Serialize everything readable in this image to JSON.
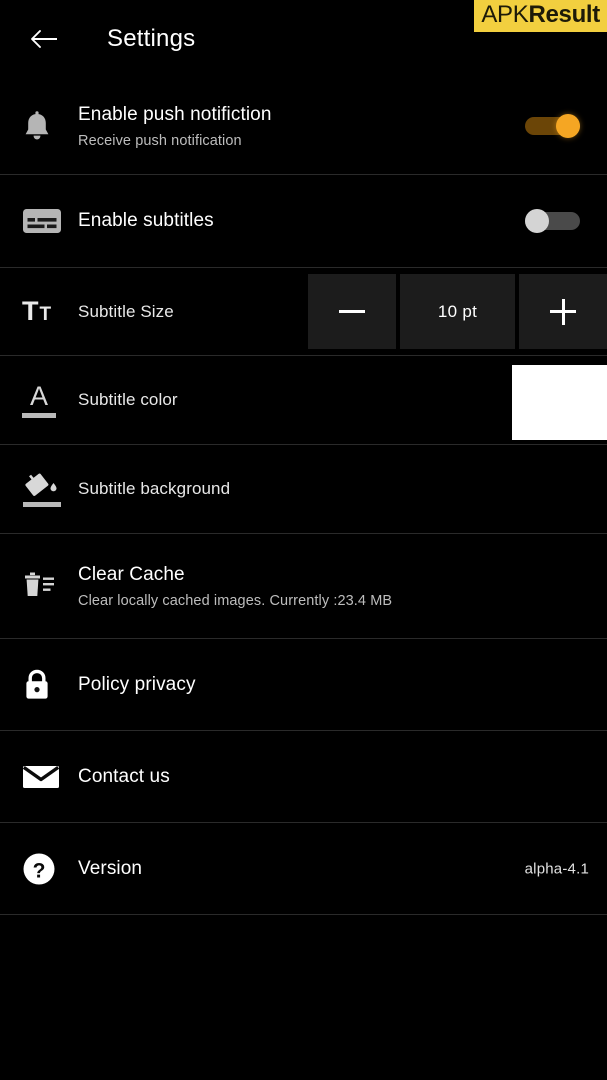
{
  "watermark": {
    "part1": "APK",
    "part2": "Result",
    "bg_color": "#f2cf3f"
  },
  "header": {
    "title": "Settings",
    "back_icon": "back-arrow-icon"
  },
  "colors": {
    "background": "#000000",
    "divider": "#2a2a2a",
    "toggle_on_thumb": "#f5a623",
    "toggle_on_track": "#6b4507",
    "toggle_off_thumb": "#d4d4d4",
    "toggle_off_track": "#4a4a4a",
    "stepper_cell": "#1c1c1c",
    "subtitle_color_swatch": "#ffffff"
  },
  "rows": {
    "push": {
      "icon": "bell-icon",
      "title": "Enable push notifiction",
      "subtitle": "Receive push notification",
      "toggle_state": "on"
    },
    "subtitles": {
      "icon": "subtitles-icon",
      "title": "Enable subtitles",
      "toggle_state": "off"
    },
    "subtitle_size": {
      "icon": "text-size-icon",
      "title": "Subtitle Size",
      "decrease_label": "—",
      "value": "10 pt",
      "increase_label": "+"
    },
    "subtitle_color": {
      "icon": "text-color-icon",
      "title": "Subtitle color",
      "swatch": "#ffffff"
    },
    "subtitle_background": {
      "icon": "paint-bucket-icon",
      "title": "Subtitle background"
    },
    "clear_cache": {
      "icon": "trash-icon",
      "title": "Clear Cache",
      "subtitle": "Clear locally cached images. Currently :23.4 MB"
    },
    "policy": {
      "icon": "lock-icon",
      "title": "Policy privacy"
    },
    "contact": {
      "icon": "envelope-icon",
      "title": "Contact us"
    },
    "version": {
      "icon": "question-mark-icon",
      "title": "Version",
      "value": "alpha-4.1"
    }
  }
}
